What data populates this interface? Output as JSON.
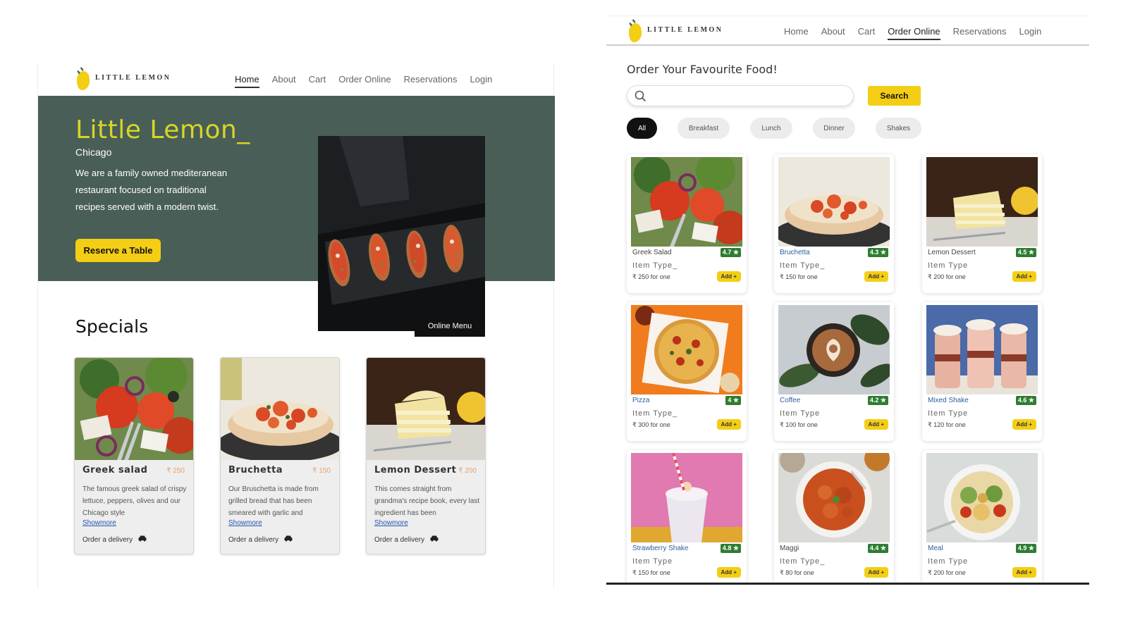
{
  "home": {
    "logo_text": "LITTLE LEMON",
    "nav": [
      "Home",
      "About",
      "Cart",
      "Order Online",
      "Reservations",
      "Login"
    ],
    "nav_active": "Home",
    "hero": {
      "title": "Little Lemon",
      "cursor": "_",
      "city": "Chicago",
      "description": "We are a family owned mediteranean restaurant focused on traditional recipes served with a modern twist.",
      "cta": "Reserve a Table"
    },
    "specials_title": "Specials",
    "online_menu_label": "Online Menu",
    "specials": [
      {
        "name": "Greek salad",
        "price": "₹ 250",
        "desc": "The famous greek salad of crispy lettuce, peppers, olives and our Chicago style",
        "more": "Showmore",
        "order": "Order a delivery"
      },
      {
        "name": "Bruchetta",
        "price": "₹ 150",
        "desc": "Our Bruschetta is made from grilled bread that has been smeared with garlic and",
        "more": "Showmore",
        "order": "Order a delivery"
      },
      {
        "name": "Lemon Dessert",
        "price": "₹ 200",
        "desc": "This comes straight from grandma's recipe book, every last ingredient has been",
        "more": "Showmore",
        "order": "Order a delivery"
      }
    ]
  },
  "order": {
    "logo_text": "LITTLE LEMON",
    "nav": [
      "Home",
      "About",
      "Cart",
      "Order Online",
      "Reservations",
      "Login"
    ],
    "nav_active": "Order Online",
    "title": "Order Your Favourite Food!",
    "search_value": "",
    "search_button": "Search",
    "chips": [
      "All",
      "Breakfast",
      "Lunch",
      "Dinner",
      "Shakes"
    ],
    "chip_active": "All",
    "add_label": "Add +",
    "items": [
      {
        "name": "Greek Salad",
        "rating": "4.7 ★",
        "type": "Item Type_",
        "price": "₹ 250 for one"
      },
      {
        "name": "Bruchetta",
        "rating": "4.3 ★",
        "type": "Item Type_",
        "price": "₹ 150 for one"
      },
      {
        "name": "Lemon Dessert",
        "rating": "4.5 ★",
        "type": "Item Type",
        "price": "₹ 200 for one"
      },
      {
        "name": "Pizza",
        "rating": "4 ★",
        "type": "Item Type_",
        "price": "₹ 300 for one"
      },
      {
        "name": "Coffee",
        "rating": "4.2 ★",
        "type": "Item Type",
        "price": "₹ 100 for one"
      },
      {
        "name": "Mixed Shake",
        "rating": "4.6 ★",
        "type": "Item Type",
        "price": "₹ 120 for one"
      },
      {
        "name": "Strawberry Shake",
        "rating": "4.8 ★",
        "type": "Item Type",
        "price": "₹ 150 for one"
      },
      {
        "name": "Maggi",
        "rating": "4.4 ★",
        "type": "Item Type_",
        "price": "₹ 80 for one"
      },
      {
        "name": "Meal",
        "rating": "4.9 ★",
        "type": "Item Type",
        "price": "₹ 200 for one"
      }
    ]
  },
  "colors": {
    "primary_green": "#495e57",
    "primary_yellow": "#f4ce14",
    "title_yellow": "#d6d626",
    "rating_green": "#2e7d32",
    "link_blue": "#2456b0"
  }
}
